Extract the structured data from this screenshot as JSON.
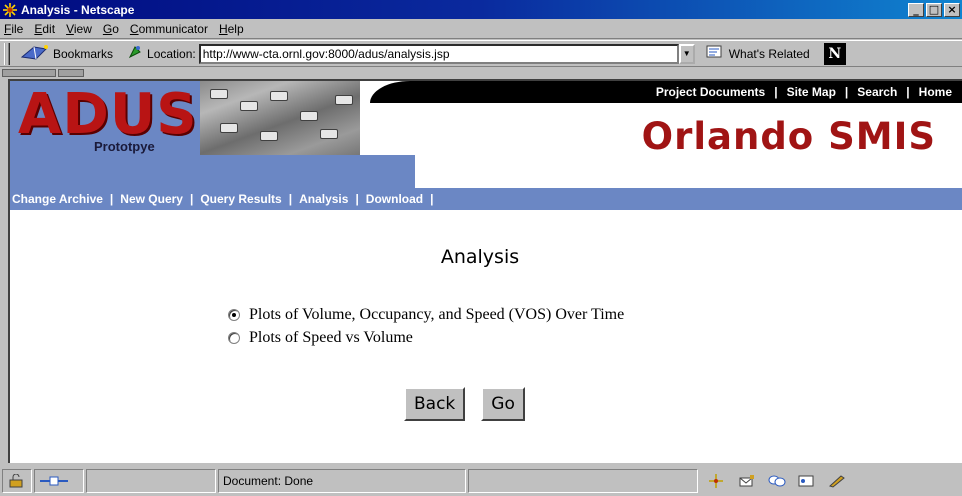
{
  "window": {
    "title": "Analysis - Netscape",
    "buttons": [
      "_",
      "□",
      "×"
    ]
  },
  "menubar": [
    {
      "label": "File",
      "ul": "F",
      "rest": "ile"
    },
    {
      "label": "Edit",
      "ul": "E",
      "rest": "dit"
    },
    {
      "label": "View",
      "ul": "V",
      "rest": "iew"
    },
    {
      "label": "Go",
      "ul": "G",
      "rest": "o"
    },
    {
      "label": "Communicator",
      "ul": "C",
      "rest": "ommunicator"
    },
    {
      "label": "Help",
      "ul": "H",
      "rest": "elp"
    }
  ],
  "location_bar": {
    "bookmarks_label": "Bookmarks",
    "location_label": "Location:",
    "url": "http://www-cta.ornl.gov:8000/adus/analysis.jsp",
    "related_label": "What's Related"
  },
  "banner": {
    "logo_text": "ADUS",
    "logo_subtext": "Prototpye",
    "site_title": "Orlando SMIS",
    "top_links": [
      "Project Documents",
      "Site Map",
      "Search",
      "Home"
    ],
    "sub_links": [
      "Change Archive",
      "New Query",
      "Query Results",
      "Analysis",
      "Download"
    ]
  },
  "page": {
    "title": "Analysis",
    "options": [
      {
        "label": "Plots of Volume, Occupancy, and Speed (VOS) Over Time",
        "selected": true
      },
      {
        "label": "Plots of Speed vs Volume",
        "selected": false
      }
    ],
    "back_label": "Back",
    "go_label": "Go"
  },
  "statusbar": {
    "text": "Document: Done"
  },
  "colors": {
    "banner_blue": "#6b87c4",
    "logo_red": "#b81414",
    "title_red": "#a01414"
  }
}
